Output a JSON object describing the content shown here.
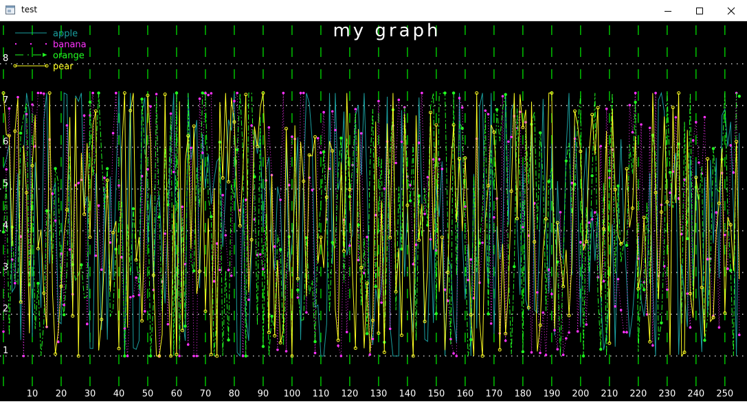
{
  "window": {
    "title": "test"
  },
  "chart_data": {
    "type": "line",
    "title": "my graph",
    "xlim": [
      0,
      256
    ],
    "ylim": [
      0.6,
      8.5
    ],
    "x_ticks": [
      10,
      20,
      30,
      40,
      50,
      60,
      70,
      80,
      90,
      100,
      110,
      120,
      130,
      140,
      150,
      160,
      170,
      180,
      190,
      200,
      210,
      220,
      230,
      240,
      250
    ],
    "y_ticks": [
      1,
      2,
      3,
      4,
      5,
      6,
      7,
      8
    ],
    "legend_position": "top-left",
    "grid": true,
    "colors": {
      "background": "#000000",
      "axis_text": "#ffffff",
      "grid_vertical": "#00e000",
      "grid_horizontal": "#c8c8c8"
    },
    "series": [
      {
        "name": "apple",
        "color": "#1aa0a0",
        "style": "solid",
        "marker": "none"
      },
      {
        "name": "banana",
        "color": "#ff33ff",
        "style": "dotted",
        "marker": "dot"
      },
      {
        "name": "orange",
        "color": "#22ff22",
        "style": "dash-dot",
        "marker": "arrow"
      },
      {
        "name": "pear",
        "color": "#ffff22",
        "style": "solid",
        "marker": "circle"
      }
    ]
  }
}
